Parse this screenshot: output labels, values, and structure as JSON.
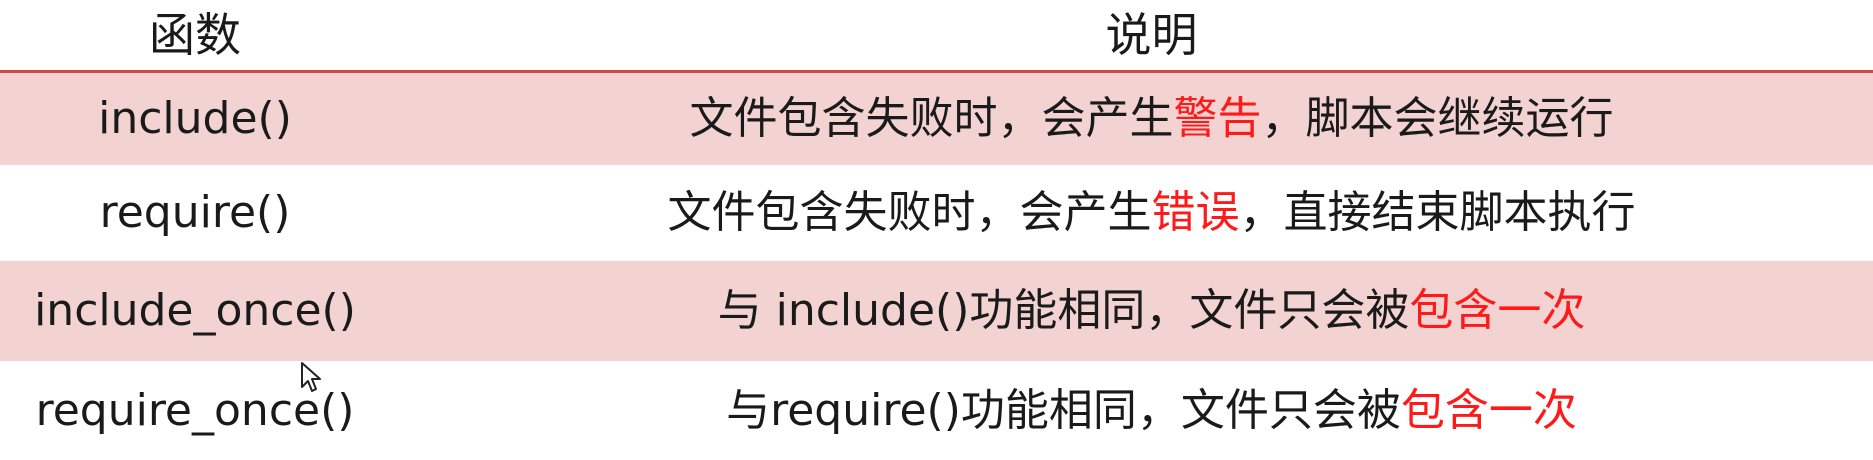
{
  "table": {
    "headers": [
      "函数",
      "说明"
    ],
    "rows": [
      {
        "function": "include()",
        "desc_before": "文件包含失败时，会产生",
        "desc_highlight": "警告",
        "desc_after": "，脚本会继续运行"
      },
      {
        "function": "require()",
        "desc_before": "文件包含失败时，会产生",
        "desc_highlight": "错误",
        "desc_after": "，直接结束脚本执行"
      },
      {
        "function": "include_once()",
        "desc_before": "与 include()功能相同，文件只会被",
        "desc_highlight": "包含一次",
        "desc_after": ""
      },
      {
        "function": "require_once()",
        "desc_before": "与require()功能相同，文件只会被",
        "desc_highlight": "包含一次",
        "desc_after": ""
      }
    ]
  },
  "colors": {
    "header_rule": "#cf4a46",
    "band": "#f2d3d2",
    "highlight": "#ff1a1a",
    "text": "#1a1a1a"
  },
  "icons": {
    "cursor": "mouse-pointer-icon"
  }
}
